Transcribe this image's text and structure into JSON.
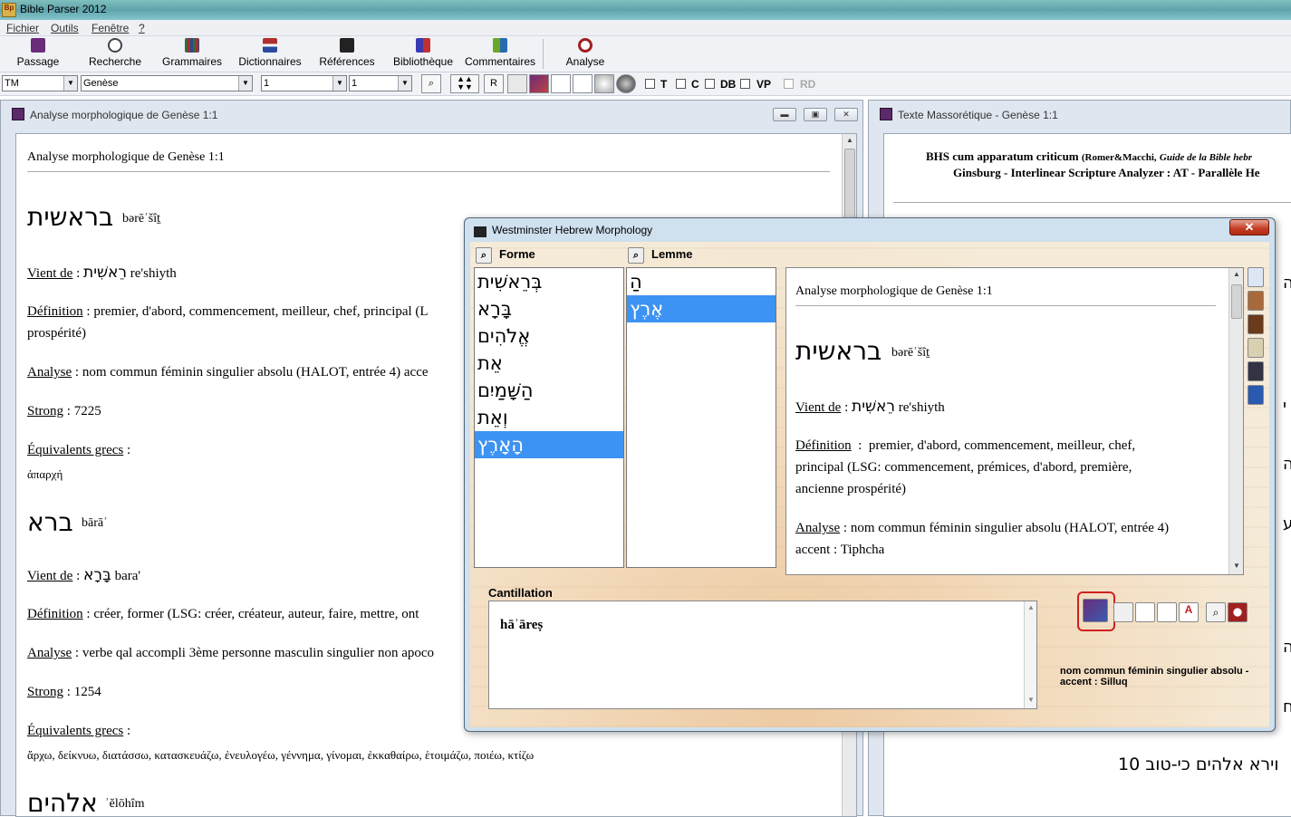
{
  "app": {
    "title": "Bible Parser 2012",
    "icon_text": "Bp"
  },
  "menu": [
    {
      "label": "Fichier"
    },
    {
      "label": "Outils"
    },
    {
      "label": "Fenêtre"
    },
    {
      "label": "?"
    }
  ],
  "toolbar": [
    {
      "label": "Passage",
      "icon": "book-icon",
      "color": "#6a2d7a"
    },
    {
      "label": "Recherche",
      "icon": "search-icon",
      "color": "#444444"
    },
    {
      "label": "Grammaires",
      "icon": "books-icon",
      "color": "#3a6a3a"
    },
    {
      "label": "Dictionnaires",
      "icon": "dictionary-icon",
      "color": "#b03030"
    },
    {
      "label": "Références",
      "icon": "references-icon",
      "color": "#222222"
    },
    {
      "label": "Bibliothèque",
      "icon": "library-icon",
      "color": "#3a3ab0"
    },
    {
      "label": "Commentaires",
      "icon": "commentary-icon",
      "color": "#6aa62a"
    },
    {
      "label": "Analyse",
      "icon": "analysis-icon",
      "color": "#a02020"
    }
  ],
  "toolbar2": {
    "version": "TM",
    "book": "Genèse",
    "chapter": "1",
    "verse": "1",
    "r_button": "R",
    "checkboxes": [
      {
        "label": "T",
        "enabled": true
      },
      {
        "label": "C",
        "enabled": true
      },
      {
        "label": "DB",
        "enabled": true
      },
      {
        "label": "VP",
        "enabled": true
      },
      {
        "label": "RD",
        "enabled": false
      }
    ]
  },
  "left_window": {
    "title": "Analyse morphologique de Genèse 1:1",
    "doc_title": "Analyse morphologique de Genèse 1:1",
    "entries": [
      {
        "hebrew": "בראשית",
        "translit": "bərēʾšîṯ",
        "vient_de_label": "Vient de",
        "vient_de_hebrew": "רֵאשִׁית",
        "vient_de_translit": "re'shiyth",
        "definition_label": "Définition",
        "definition": "premier, d'abord, commencement, meilleur, chef, principal (L",
        "definition_cont": "prospérité)",
        "analyse_label": "Analyse",
        "analyse": "nom commun féminin singulier absolu (HALOT, entrée 4) acce",
        "strong_label": "Strong",
        "strong": "7225",
        "greek_label": "Équivalents grecs",
        "greek": "ἀπαρχή"
      },
      {
        "hebrew": "ברא",
        "translit": "bārāʾ",
        "vient_de_label": "Vient de",
        "vient_de_hebrew": "בָּרָא",
        "vient_de_translit": "bara'",
        "definition_label": "Définition",
        "definition": "créer, former (LSG: créer, créateur, auteur, faire, mettre, ont",
        "analyse_label": "Analyse",
        "analyse": "verbe qal accompli 3ème personne masculin singulier non apoco",
        "strong_label": "Strong",
        "strong": "1254",
        "greek_label": "Équivalents grecs",
        "greek": "ἄρχω, δείκνυω, διατάσσω, κατασκευάζω, ἐνευλογέω, γέννημα, γίνομαι, ἐκκαθαίρω, ἑτοιμάζω, ποιέω, κτίζω"
      },
      {
        "hebrew": "אלהים",
        "translit": "ʾĕlōhîm"
      }
    ]
  },
  "right_window": {
    "title": "Texte Massorétique - Genèse 1:1",
    "line1_a": "BHS cum apparatum criticum",
    "line1_b": "(Romer&Macchi,",
    "line1_c": "Guide de la Bible hebr",
    "line2": "Ginsburg - Interlinear Scripture Analyzer : AT - Parallèle He",
    "bottom_hebrew": "10 וירא אלהים כי-טוב",
    "side_letters": [
      "ה",
      "י",
      "ה",
      "ע",
      "ה",
      "ח"
    ]
  },
  "dialog": {
    "title": "Westminster Hebrew Morphology",
    "close": "✕",
    "col_forme": "Forme",
    "col_lemme": "Lemme",
    "formes": [
      "בְּרֵאשִׁית",
      "בָּרָא",
      "אֱלֹהִים",
      "אֵת",
      "הַשָּׁמַיִם",
      "וְאֵת",
      "הָאָרֶץ"
    ],
    "forme_selected": 6,
    "lemmes": [
      "הַ",
      "אֶרֶץ"
    ],
    "lemme_selected": 1,
    "doc": {
      "title": "Analyse morphologique de Genèse 1:1",
      "hebrew": "בראשית",
      "translit": "bərēʾšîṯ",
      "vient_de_label": "Vient de",
      "vient_de_hebrew": "רֵאשִׁית",
      "vient_de_translit": "re'shiyth",
      "definition_label": "Définition",
      "definition_l1": "premier, d'abord, commencement, meilleur, chef,",
      "definition_l2": "principal (LSG: commencement, prémices, d'abord, première,",
      "definition_l3": "ancienne prospérité)",
      "analyse_label": "Analyse",
      "analyse": "nom commun féminin singulier absolu (HALOT, entrée 4)",
      "accent": "accent : Tiphcha"
    },
    "cantillation_label": "Cantillation",
    "cantillation_value": "hāʾāreṣ",
    "morph_note_l1": "nom commun féminin singulier absolu -",
    "morph_note_l2": "accent : Silluq"
  }
}
